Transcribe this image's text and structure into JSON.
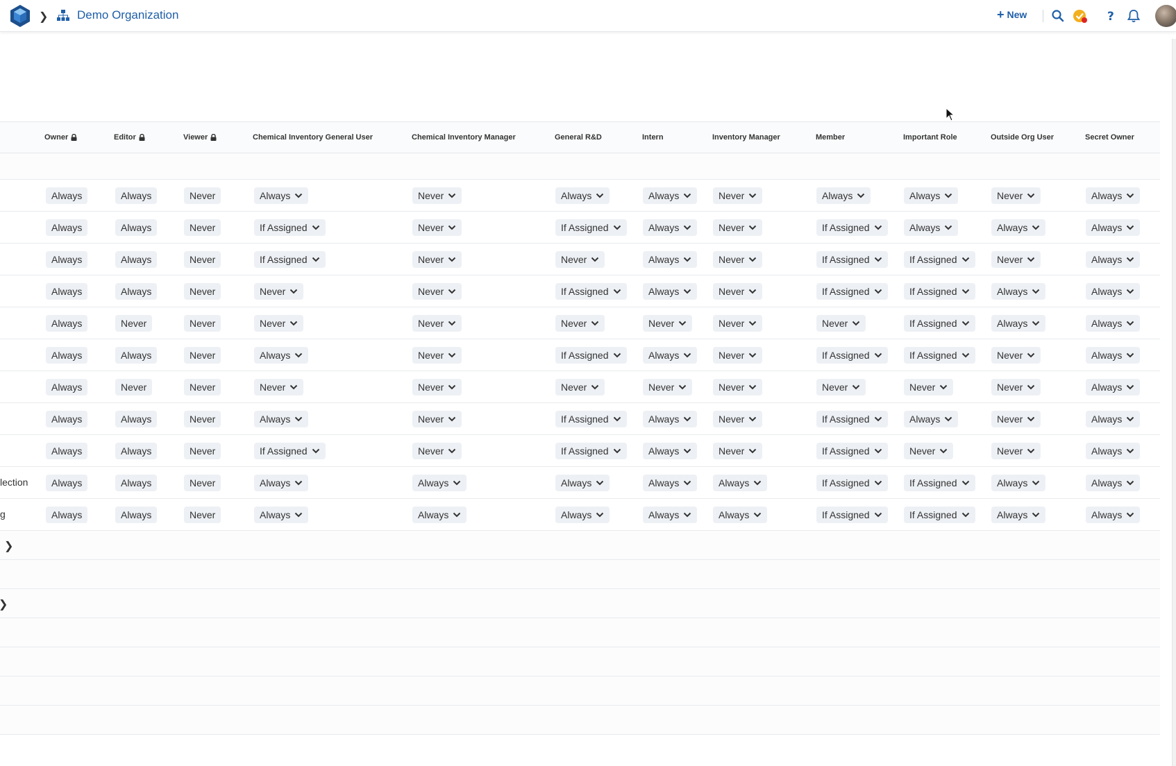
{
  "header": {
    "org_name": "Demo Organization",
    "new_label": "New"
  },
  "columns": [
    {
      "label": "Owner",
      "locked": true
    },
    {
      "label": "Editor",
      "locked": true
    },
    {
      "label": "Viewer",
      "locked": true
    },
    {
      "label": "Chemical Inventory General User",
      "locked": false
    },
    {
      "label": "Chemical Inventory Manager",
      "locked": false
    },
    {
      "label": "General R&D",
      "locked": false
    },
    {
      "label": "Intern",
      "locked": false
    },
    {
      "label": "Inventory Manager",
      "locked": false
    },
    {
      "label": "Member",
      "locked": false
    },
    {
      "label": "Important Role",
      "locked": false
    },
    {
      "label": "Outside Org User",
      "locked": false
    },
    {
      "label": "Secret Owner",
      "locked": false
    }
  ],
  "rows": [
    {
      "label": "",
      "values": [
        "Always",
        "Always",
        "Never",
        "Always",
        "Never",
        "Always",
        "Always",
        "Never",
        "Always",
        "Always",
        "Never",
        "Always"
      ]
    },
    {
      "label": "",
      "values": [
        "Always",
        "Always",
        "Never",
        "If Assigned",
        "Never",
        "If Assigned",
        "Always",
        "Never",
        "If Assigned",
        "Always",
        "Always",
        "Always"
      ]
    },
    {
      "label": "",
      "values": [
        "Always",
        "Always",
        "Never",
        "If Assigned",
        "Never",
        "Never",
        "Always",
        "Never",
        "If Assigned",
        "If Assigned",
        "Never",
        "Always"
      ]
    },
    {
      "label": "",
      "values": [
        "Always",
        "Always",
        "Never",
        "Never",
        "Never",
        "If Assigned",
        "Always",
        "Never",
        "If Assigned",
        "If Assigned",
        "Always",
        "Always"
      ]
    },
    {
      "label": "",
      "values": [
        "Always",
        "Never",
        "Never",
        "Never",
        "Never",
        "Never",
        "Never",
        "Never",
        "Never",
        "If Assigned",
        "Always",
        "Always"
      ]
    },
    {
      "label": "",
      "values": [
        "Always",
        "Always",
        "Never",
        "Always",
        "Never",
        "If Assigned",
        "Always",
        "Never",
        "If Assigned",
        "If Assigned",
        "Never",
        "Always"
      ]
    },
    {
      "label": "",
      "values": [
        "Always",
        "Never",
        "Never",
        "Never",
        "Never",
        "Never",
        "Never",
        "Never",
        "Never",
        "Never",
        "Never",
        "Always"
      ]
    },
    {
      "label": "",
      "values": [
        "Always",
        "Always",
        "Never",
        "Always",
        "Never",
        "If Assigned",
        "Always",
        "Never",
        "If Assigned",
        "Always",
        "Never",
        "Always"
      ]
    },
    {
      "label": "",
      "values": [
        "Always",
        "Always",
        "Never",
        "If Assigned",
        "Never",
        "If Assigned",
        "Always",
        "Never",
        "If Assigned",
        "Never",
        "Never",
        "Always"
      ]
    },
    {
      "label": "lection",
      "values": [
        "Always",
        "Always",
        "Never",
        "Always",
        "Always",
        "Always",
        "Always",
        "Always",
        "If Assigned",
        "If Assigned",
        "Always",
        "Always"
      ]
    },
    {
      "label": "g",
      "values": [
        "Always",
        "Always",
        "Never",
        "Always",
        "Always",
        "Always",
        "Always",
        "Always",
        "If Assigned",
        "If Assigned",
        "Always",
        "Always"
      ]
    }
  ]
}
